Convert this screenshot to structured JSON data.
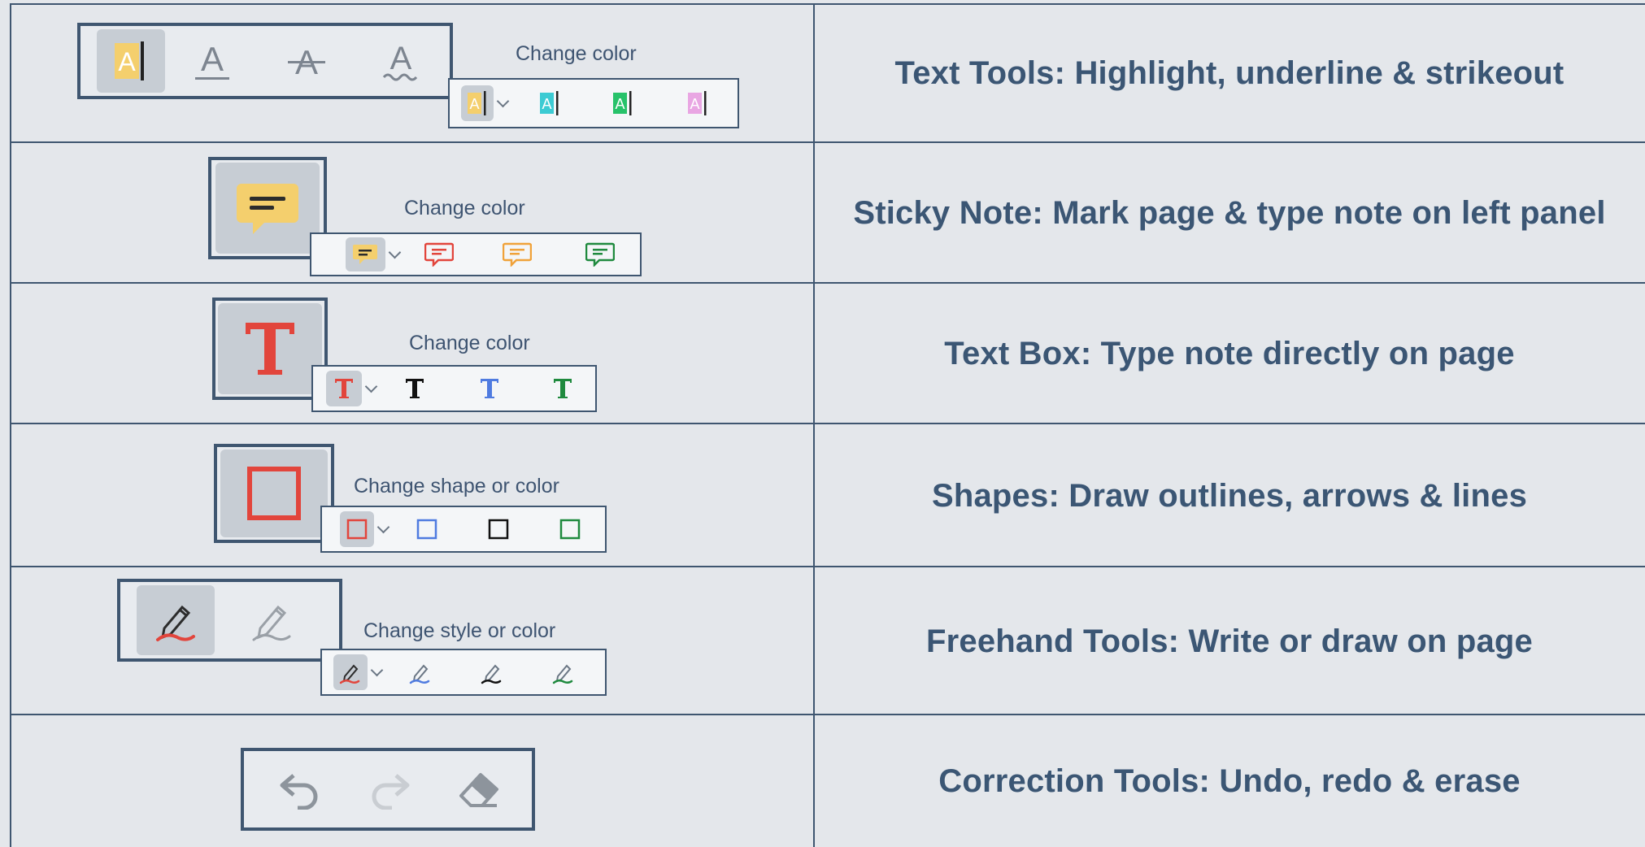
{
  "colors": {
    "border": "#3f5670",
    "text": "#3b5674",
    "highlight_yellow": "#f4cf6d",
    "highlight_cyan": "#3ccbd3",
    "highlight_green": "#27c26a",
    "highlight_pink": "#e9a6e3",
    "red": "#e2453c",
    "blue": "#4f7be0",
    "black": "#111111",
    "green": "#1f8a3e",
    "orange": "#f0a23a",
    "grey": "#9aa0a7"
  },
  "rows": [
    {
      "id": "text-tools",
      "description": "Text Tools:  Highlight, underline & strikeout",
      "palette_label": "Change color",
      "tools": [
        "highlight-icon",
        "underline-icon",
        "strikeout-icon",
        "squiggly-underline-icon"
      ],
      "swatches": [
        "highlight-yellow-icon",
        "highlight-cyan-icon",
        "highlight-green-icon",
        "highlight-pink-icon"
      ]
    },
    {
      "id": "sticky-note",
      "description": "Sticky Note:  Mark page & type note on left panel",
      "palette_label": "Change color",
      "tools": [
        "sticky-note-icon"
      ],
      "swatches": [
        "note-yellow-icon",
        "note-red-icon",
        "note-orange-icon",
        "note-green-icon"
      ]
    },
    {
      "id": "text-box",
      "description": "Text Box:  Type note directly on page",
      "palette_label": "Change color",
      "tools": [
        "text-box-icon"
      ],
      "swatches": [
        "text-red-icon",
        "text-black-icon",
        "text-blue-icon",
        "text-green-icon"
      ]
    },
    {
      "id": "shapes",
      "description": "Shapes:  Draw outlines, arrows & lines",
      "palette_label": "Change shape or color",
      "tools": [
        "square-shape-icon"
      ],
      "swatches": [
        "square-red-icon",
        "square-blue-icon",
        "square-black-icon",
        "square-green-icon"
      ]
    },
    {
      "id": "freehand",
      "description": "Freehand Tools:  Write or draw on page",
      "palette_label": "Change style or color",
      "tools": [
        "pen-icon",
        "highlighter-pen-icon"
      ],
      "swatches": [
        "pen-red-icon",
        "pen-blue-icon",
        "pen-black-icon",
        "pen-green-icon"
      ]
    },
    {
      "id": "correction",
      "description": "Correction Tools:  Undo, redo & erase",
      "tools": [
        "undo-icon",
        "redo-icon",
        "eraser-icon"
      ]
    }
  ]
}
